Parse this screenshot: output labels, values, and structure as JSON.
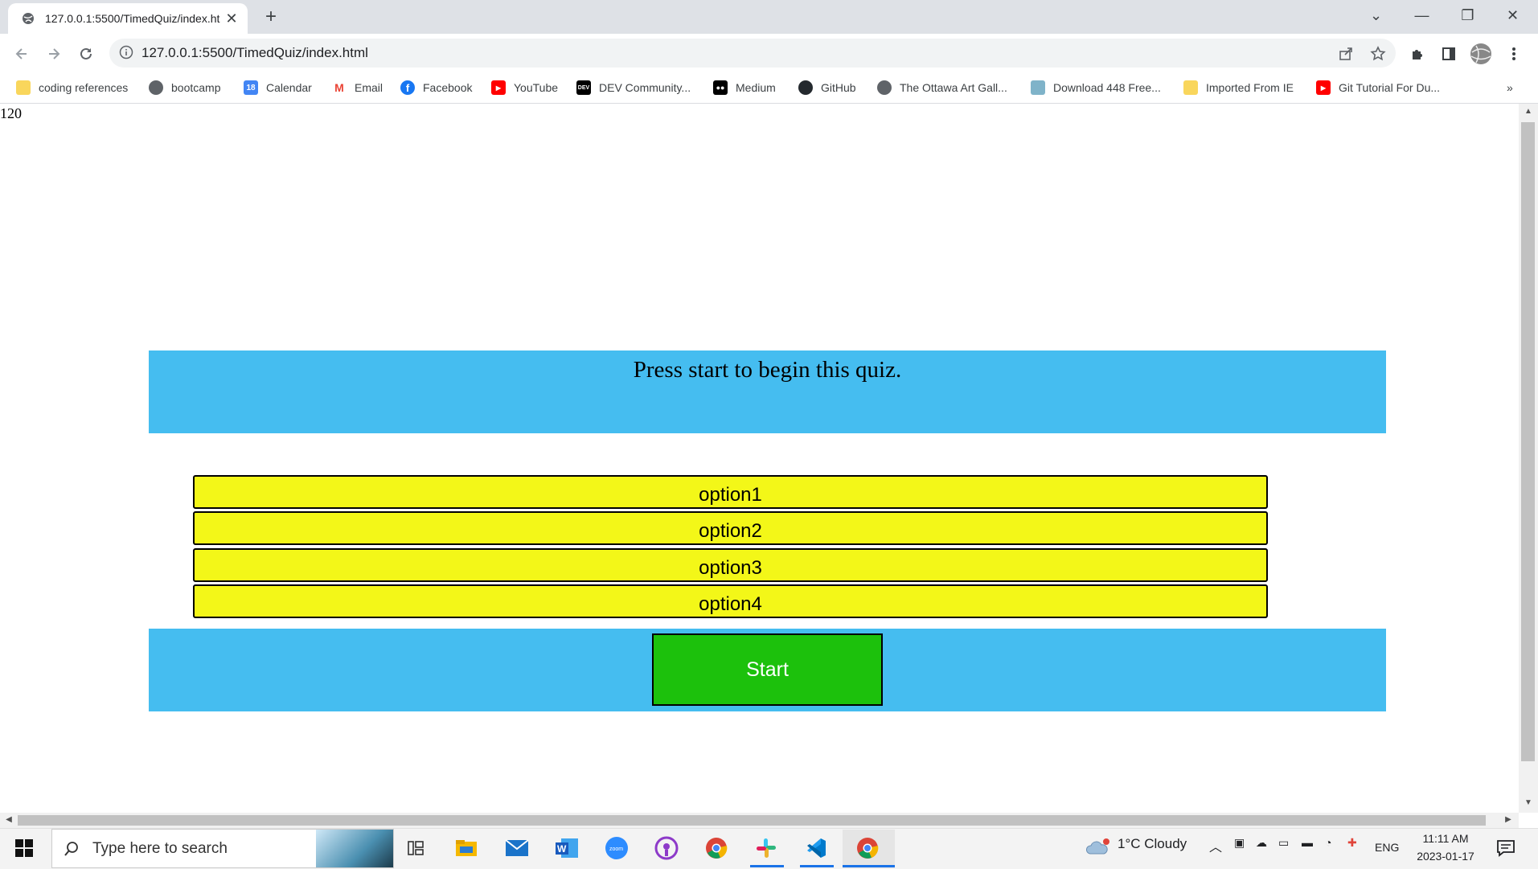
{
  "browser": {
    "tab_title": "127.0.0.1:5500/TimedQuiz/index.html",
    "url": "127.0.0.1:5500/TimedQuiz/index.html"
  },
  "bookmarks": [
    {
      "label": "coding references",
      "icon": "folder-icon"
    },
    {
      "label": "bootcamp",
      "icon": "globe-icon"
    },
    {
      "label": "Calendar",
      "icon": "calendar-icon"
    },
    {
      "label": "Email",
      "icon": "gmail-icon"
    },
    {
      "label": "Facebook",
      "icon": "facebook-icon"
    },
    {
      "label": "YouTube",
      "icon": "youtube-icon"
    },
    {
      "label": "DEV Community...",
      "icon": "dev-icon"
    },
    {
      "label": "Medium",
      "icon": "medium-icon"
    },
    {
      "label": "GitHub",
      "icon": "github-icon"
    },
    {
      "label": "The Ottawa Art Gall...",
      "icon": "globe-icon"
    },
    {
      "label": "Download 448 Free...",
      "icon": "download-icon"
    },
    {
      "label": "Imported From IE",
      "icon": "folder-icon"
    },
    {
      "label": "Git Tutorial For Du...",
      "icon": "youtube-icon"
    }
  ],
  "quiz": {
    "timer": "120",
    "question": "Press start to begin this quiz.",
    "options": [
      "option1",
      "option2",
      "option3",
      "option4"
    ],
    "start_label": "Start"
  },
  "taskbar": {
    "search_placeholder": "Type here to search",
    "weather": "1°C  Cloudy",
    "language": "ENG",
    "time": "11:11 AM",
    "date": "2023-01-17"
  },
  "colors": {
    "quiz_blue": "#45bdf0",
    "option_yellow": "#f3f718",
    "start_green": "#1cc10c"
  }
}
